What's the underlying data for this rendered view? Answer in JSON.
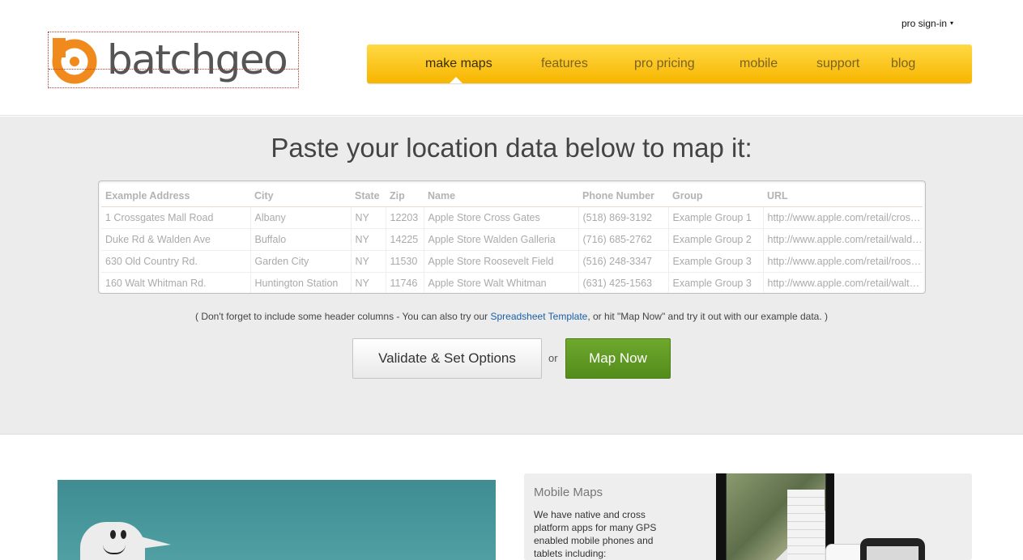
{
  "header": {
    "logo_text": "batchgeo",
    "signin_label": "pro sign-in",
    "signin_caret": "▾",
    "nav": [
      "make maps",
      "features",
      "pro pricing",
      "mobile",
      "support",
      "blog"
    ],
    "colors": {
      "nav_gradient_top": "#ffd944",
      "nav_gradient_bottom": "#f7b500",
      "logo_orange": "#f08a1c"
    }
  },
  "hero": {
    "title": "Paste your location data below to map it:",
    "table": {
      "headers": [
        "Example Address",
        "City",
        "State",
        "Zip",
        "Name",
        "Phone Number",
        "Group",
        "URL"
      ],
      "rows": [
        [
          "1 Crossgates Mall Road",
          "Albany",
          "NY",
          "12203",
          "Apple Store Cross Gates",
          "(518) 869-3192",
          "Example Group 1",
          "http://www.apple.com/retail/crossgates/"
        ],
        [
          "Duke Rd & Walden Ave",
          "Buffalo",
          "NY",
          "14225",
          "Apple Store Walden Galleria",
          "(716) 685-2762",
          "Example Group 2",
          "http://www.apple.com/retail/walden/"
        ],
        [
          "630 Old Country Rd.",
          "Garden City",
          "NY",
          "11530",
          "Apple Store Roosevelt Field",
          "(516) 248-3347",
          "Example Group 3",
          "http://www.apple.com/retail/rooseveltfield/"
        ],
        [
          "160 Walt Whitman Rd.",
          "Huntington Station",
          "NY",
          "11746",
          "Apple Store Walt Whitman",
          "(631) 425-1563",
          "Example Group 3",
          "http://www.apple.com/retail/waltwhitman/"
        ]
      ]
    },
    "hint_before": "( Don't forget to include some header columns - You can also try our ",
    "hint_link": "Spreadsheet Template",
    "hint_after": ", or hit \"Map Now\" and try it out with our example data. )",
    "validate_label": "Validate & Set Options",
    "or_label": "or",
    "map_now_label": "Map Now",
    "colors": {
      "background": "#ececec",
      "map_now_green": "#5f9a24",
      "link_blue": "#1a5fa8"
    }
  },
  "mobile": {
    "title": "Mobile Maps",
    "text": "We have native and cross platform apps for many GPS enabled mobile phones and tablets including:"
  }
}
